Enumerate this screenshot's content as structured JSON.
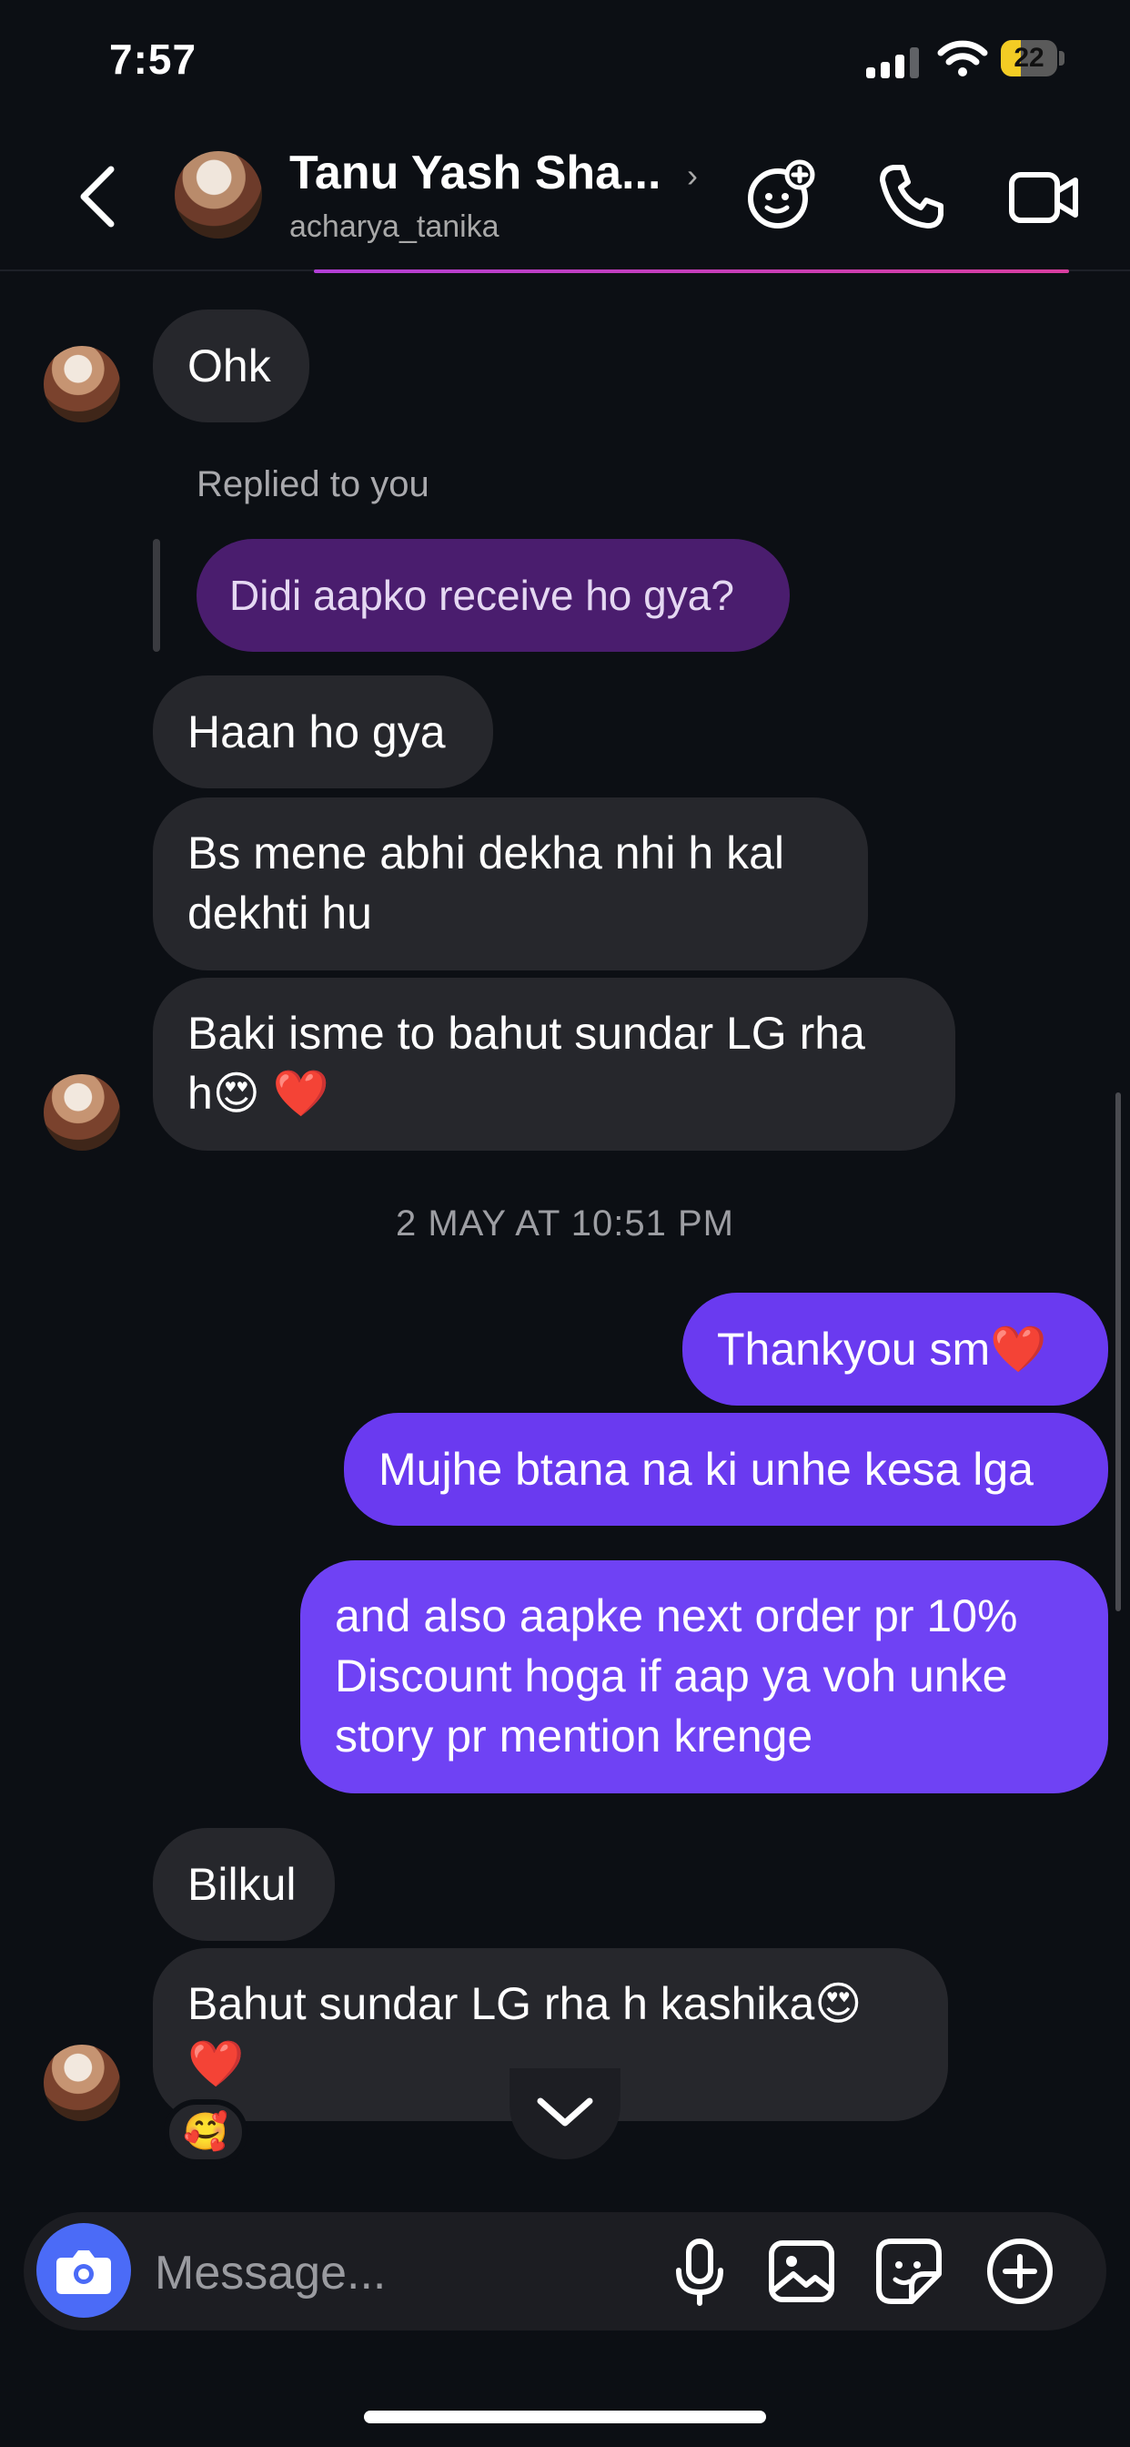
{
  "status": {
    "time": "7:57",
    "battery": "22"
  },
  "header": {
    "name": "Tanu Yash Sha...",
    "username": "acharya_tanika",
    "icons": [
      "back-chevron-icon",
      "ai-sparkle-icon",
      "phone-icon",
      "video-icon"
    ]
  },
  "messages": {
    "m1": "Ohk",
    "reply_label": "Replied to you",
    "reply_quote": "Didi aapko receive ho gya?",
    "m2": "Haan ho gya",
    "m3_line1": "Bs mene abhi dekha nhi h kal",
    "m3_line2": "dekhti hu",
    "m4_line1": "Baki isme to bahut sundar LG rha",
    "m4_line2": "h😍 ❤️",
    "date": "2 MAY AT 10:51 PM",
    "o1": "Thankyou sm❤️",
    "o2": "Mujhe btana na ki unhe kesa lga",
    "o3_line1": "and also aapke next order pr 10%",
    "o3_line2": "Discount hoga if aap ya voh unke",
    "o3_line3": "story pr mention krenge",
    "m5": "Bilkul",
    "m6_line1": "Bahut sundar LG rha h kashika😍",
    "m6_line2": "❤️",
    "reaction": "🥰"
  },
  "composer": {
    "placeholder": "Message..."
  },
  "colors": {
    "background": "#0c0f14",
    "incoming": "#26272c",
    "outgoing": "#6a3af0",
    "reply": "#4a1d6e",
    "camera": "#4b6bf7"
  }
}
